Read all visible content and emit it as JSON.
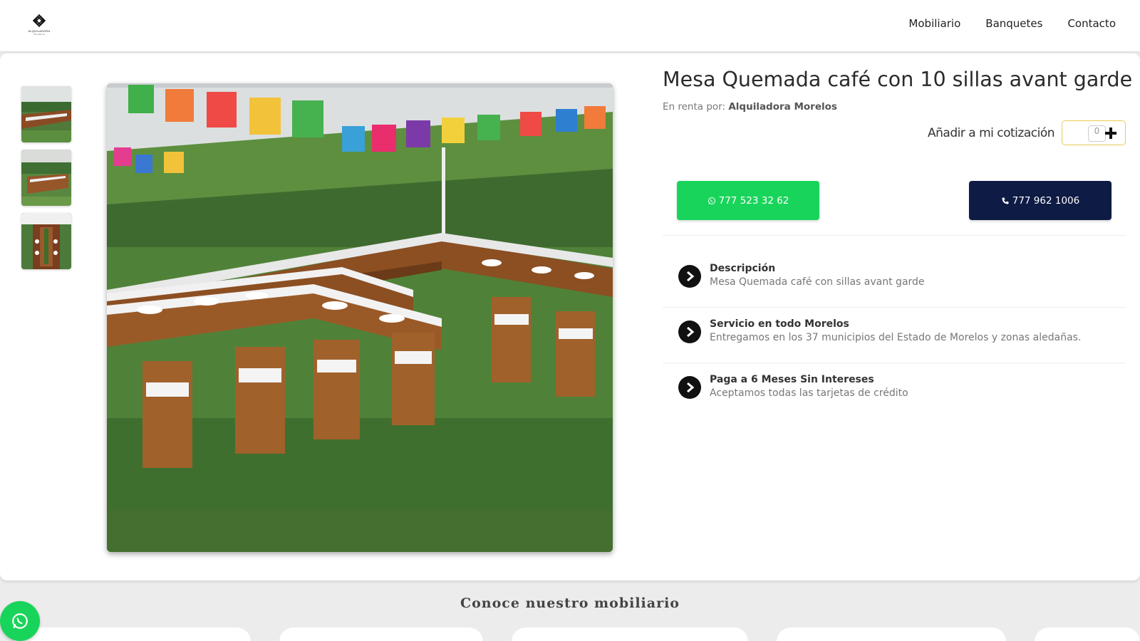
{
  "header": {
    "logo_text": "ALQUILADORA",
    "logo_subtext": "San Marcos",
    "nav": [
      "Mobiliario",
      "Banquetes",
      "Contacto"
    ]
  },
  "product": {
    "title": "Mesa Quemada café con  10 sillas avant garde",
    "byline_prefix": "En renta por: ",
    "vendor": "Alquiladora Morelos",
    "quote_label": "Añadir a mi cotización",
    "quantity": "0",
    "whatsapp_label": "777 523 32 62",
    "phone_label": "777 962 1006"
  },
  "features": [
    {
      "title": "Descripción",
      "text": "Mesa Quemada café  con sillas avant garde"
    },
    {
      "title": "Servicio en todo Morelos",
      "text": "Entregamos en los 37 municipios del Estado de Morelos y zonas aledañas."
    },
    {
      "title": "Paga a 6 Meses Sin Intereses",
      "text": "Aceptamos todas las tarjetas de crédito"
    }
  ],
  "section": {
    "title": "Conoce nuestro mobiliario"
  },
  "colors": {
    "whatsapp_green": "#19d45a",
    "phone_navy": "#0e1b45",
    "quantity_border": "#e6cc55"
  },
  "icons": [
    "whatsapp-icon",
    "phone-icon",
    "chevron-right-icon",
    "plus-icon"
  ]
}
